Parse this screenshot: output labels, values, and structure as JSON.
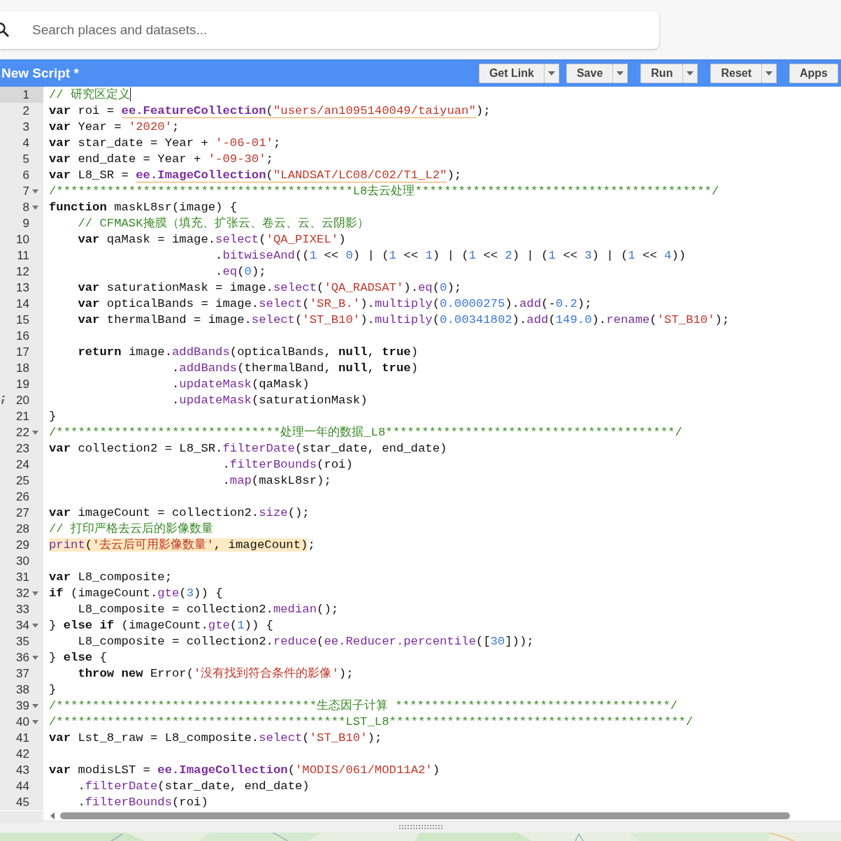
{
  "search": {
    "placeholder": "Search places and datasets..."
  },
  "toolbar": {
    "title": "New Script *",
    "buttons": [
      {
        "label": "Get Link",
        "dropdown": true
      },
      {
        "label": "Save",
        "dropdown": true
      },
      {
        "label": "Run",
        "dropdown": true
      },
      {
        "label": "Reset",
        "dropdown": true
      },
      {
        "label": "Apps",
        "dropdown": false
      }
    ]
  },
  "editor": {
    "lines": [
      {
        "number": "1",
        "fold": false,
        "info": false,
        "current": true,
        "tokens": [
          {
            "kind": "c",
            "text": "// 研究区定义"
          }
        ]
      },
      {
        "number": "2",
        "fold": false,
        "info": false,
        "current": false,
        "tokens": [
          {
            "kind": "kw",
            "text": "var"
          },
          {
            "kind": "p",
            "text": " roi = "
          },
          {
            "kind": "underline",
            "tokens": [
              {
                "kind": "fnb",
                "text": "ee.FeatureCollection"
              },
              {
                "kind": "p",
                "text": "("
              },
              {
                "kind": "s",
                "text": "\"users/an1095140049/taiyuan\""
              }
            ]
          },
          {
            "kind": "p",
            "text": ");"
          }
        ]
      },
      {
        "number": "3",
        "fold": false,
        "info": false,
        "current": false,
        "tokens": [
          {
            "kind": "kw",
            "text": "var"
          },
          {
            "kind": "p",
            "text": " Year = "
          },
          {
            "kind": "s",
            "text": "'2020'"
          },
          {
            "kind": "p",
            "text": ";"
          }
        ]
      },
      {
        "number": "4",
        "fold": false,
        "info": false,
        "current": false,
        "tokens": [
          {
            "kind": "kw",
            "text": "var"
          },
          {
            "kind": "p",
            "text": " star_date = Year + "
          },
          {
            "kind": "s",
            "text": "'-06-01'"
          },
          {
            "kind": "p",
            "text": ";"
          }
        ]
      },
      {
        "number": "5",
        "fold": false,
        "info": false,
        "current": false,
        "tokens": [
          {
            "kind": "kw",
            "text": "var"
          },
          {
            "kind": "p",
            "text": " end_date = Year + "
          },
          {
            "kind": "s",
            "text": "'-09-30'"
          },
          {
            "kind": "p",
            "text": ";"
          }
        ]
      },
      {
        "number": "6",
        "fold": false,
        "info": false,
        "current": false,
        "tokens": [
          {
            "kind": "kw",
            "text": "var"
          },
          {
            "kind": "p",
            "text": " L8_SR = "
          },
          {
            "kind": "underline",
            "tokens": [
              {
                "kind": "fnb",
                "text": "ee.ImageCollection"
              },
              {
                "kind": "p",
                "text": "("
              },
              {
                "kind": "s",
                "text": "\"LANDSAT/LC08/C02/T1_L2\""
              }
            ]
          },
          {
            "kind": "p",
            "text": ");"
          }
        ]
      },
      {
        "number": "7",
        "fold": true,
        "info": false,
        "current": false,
        "tokens": [
          {
            "kind": "c",
            "text": "/*****************************************L8去云处理*****************************************/"
          }
        ]
      },
      {
        "number": "8",
        "fold": true,
        "info": false,
        "current": false,
        "tokens": [
          {
            "kind": "kw",
            "text": "function"
          },
          {
            "kind": "p",
            "text": " maskL8sr(image) {"
          }
        ]
      },
      {
        "number": "9",
        "fold": false,
        "info": false,
        "current": false,
        "tokens": [
          {
            "kind": "c",
            "text": "    // CFMASK掩膜（填充、扩张云、卷云、云、云阴影）"
          }
        ]
      },
      {
        "number": "10",
        "fold": false,
        "info": false,
        "current": false,
        "tokens": [
          {
            "kind": "kw",
            "text": "    var"
          },
          {
            "kind": "p",
            "text": " qaMask = image."
          },
          {
            "kind": "fn",
            "text": "select"
          },
          {
            "kind": "p",
            "text": "("
          },
          {
            "kind": "s",
            "text": "'QA_PIXEL'"
          },
          {
            "kind": "p",
            "text": ")"
          }
        ]
      },
      {
        "number": "11",
        "fold": false,
        "info": false,
        "current": false,
        "tokens": [
          {
            "kind": "p",
            "text": "                       ."
          },
          {
            "kind": "fn",
            "text": "bitwiseAnd"
          },
          {
            "kind": "p",
            "text": "(("
          },
          {
            "kind": "n",
            "text": "1"
          },
          {
            "kind": "p",
            "text": " << "
          },
          {
            "kind": "n",
            "text": "0"
          },
          {
            "kind": "p",
            "text": ") | ("
          },
          {
            "kind": "n",
            "text": "1"
          },
          {
            "kind": "p",
            "text": " << "
          },
          {
            "kind": "n",
            "text": "1"
          },
          {
            "kind": "p",
            "text": ") | ("
          },
          {
            "kind": "n",
            "text": "1"
          },
          {
            "kind": "p",
            "text": " << "
          },
          {
            "kind": "n",
            "text": "2"
          },
          {
            "kind": "p",
            "text": ") | ("
          },
          {
            "kind": "n",
            "text": "1"
          },
          {
            "kind": "p",
            "text": " << "
          },
          {
            "kind": "n",
            "text": "3"
          },
          {
            "kind": "p",
            "text": ") | ("
          },
          {
            "kind": "n",
            "text": "1"
          },
          {
            "kind": "p",
            "text": " << "
          },
          {
            "kind": "n",
            "text": "4"
          },
          {
            "kind": "p",
            "text": "))"
          }
        ]
      },
      {
        "number": "12",
        "fold": false,
        "info": false,
        "current": false,
        "tokens": [
          {
            "kind": "p",
            "text": "                       ."
          },
          {
            "kind": "fn",
            "text": "eq"
          },
          {
            "kind": "p",
            "text": "("
          },
          {
            "kind": "n",
            "text": "0"
          },
          {
            "kind": "p",
            "text": ");"
          }
        ]
      },
      {
        "number": "13",
        "fold": false,
        "info": false,
        "current": false,
        "tokens": [
          {
            "kind": "kw",
            "text": "    var"
          },
          {
            "kind": "p",
            "text": " saturationMask = image."
          },
          {
            "kind": "fn",
            "text": "select"
          },
          {
            "kind": "p",
            "text": "("
          },
          {
            "kind": "s",
            "text": "'QA_RADSAT'"
          },
          {
            "kind": "p",
            "text": ")."
          },
          {
            "kind": "fn",
            "text": "eq"
          },
          {
            "kind": "p",
            "text": "("
          },
          {
            "kind": "n",
            "text": "0"
          },
          {
            "kind": "p",
            "text": ");"
          }
        ]
      },
      {
        "number": "14",
        "fold": false,
        "info": false,
        "current": false,
        "tokens": [
          {
            "kind": "kw",
            "text": "    var"
          },
          {
            "kind": "p",
            "text": " opticalBands = image."
          },
          {
            "kind": "fn",
            "text": "select"
          },
          {
            "kind": "p",
            "text": "("
          },
          {
            "kind": "s",
            "text": "'SR_B.'"
          },
          {
            "kind": "p",
            "text": ")."
          },
          {
            "kind": "fn",
            "text": "multiply"
          },
          {
            "kind": "p",
            "text": "("
          },
          {
            "kind": "n",
            "text": "0.0000275"
          },
          {
            "kind": "p",
            "text": ")."
          },
          {
            "kind": "fn",
            "text": "add"
          },
          {
            "kind": "p",
            "text": "(-"
          },
          {
            "kind": "n",
            "text": "0.2"
          },
          {
            "kind": "p",
            "text": ");"
          }
        ]
      },
      {
        "number": "15",
        "fold": false,
        "info": false,
        "current": false,
        "tokens": [
          {
            "kind": "kw",
            "text": "    var"
          },
          {
            "kind": "p",
            "text": " thermalBand = image."
          },
          {
            "kind": "fn",
            "text": "select"
          },
          {
            "kind": "p",
            "text": "("
          },
          {
            "kind": "s",
            "text": "'ST_B10'"
          },
          {
            "kind": "p",
            "text": ")."
          },
          {
            "kind": "fn",
            "text": "multiply"
          },
          {
            "kind": "p",
            "text": "("
          },
          {
            "kind": "n",
            "text": "0.00341802"
          },
          {
            "kind": "p",
            "text": ")."
          },
          {
            "kind": "fn",
            "text": "add"
          },
          {
            "kind": "p",
            "text": "("
          },
          {
            "kind": "n",
            "text": "149.0"
          },
          {
            "kind": "p",
            "text": ")."
          },
          {
            "kind": "fn",
            "text": "rename"
          },
          {
            "kind": "p",
            "text": "("
          },
          {
            "kind": "s",
            "text": "'ST_B10'"
          },
          {
            "kind": "p",
            "text": ");"
          }
        ]
      },
      {
        "number": "16",
        "fold": false,
        "info": false,
        "current": false
      },
      {
        "number": "17",
        "fold": false,
        "info": false,
        "current": false,
        "tokens": [
          {
            "kind": "kw",
            "text": "    return"
          },
          {
            "kind": "p",
            "text": " image."
          },
          {
            "kind": "fn",
            "text": "addBands"
          },
          {
            "kind": "p",
            "text": "(opticalBands, "
          },
          {
            "kind": "kw",
            "text": "null"
          },
          {
            "kind": "p",
            "text": ", "
          },
          {
            "kind": "kw",
            "text": "true"
          },
          {
            "kind": "p",
            "text": ")"
          }
        ]
      },
      {
        "number": "18",
        "fold": false,
        "info": false,
        "current": false,
        "tokens": [
          {
            "kind": "p",
            "text": "                 ."
          },
          {
            "kind": "fn",
            "text": "addBands"
          },
          {
            "kind": "p",
            "text": "(thermalBand, "
          },
          {
            "kind": "kw",
            "text": "null"
          },
          {
            "kind": "p",
            "text": ", "
          },
          {
            "kind": "kw",
            "text": "true"
          },
          {
            "kind": "p",
            "text": ")"
          }
        ]
      },
      {
        "number": "19",
        "fold": false,
        "info": false,
        "current": false,
        "tokens": [
          {
            "kind": "p",
            "text": "                 ."
          },
          {
            "kind": "fn",
            "text": "updateMask"
          },
          {
            "kind": "p",
            "text": "(qaMask)"
          }
        ]
      },
      {
        "number": "20",
        "fold": false,
        "info": true,
        "current": false,
        "tokens": [
          {
            "kind": "p",
            "text": "                 ."
          },
          {
            "kind": "fn",
            "text": "updateMask"
          },
          {
            "kind": "p",
            "text": "(saturationMask)"
          }
        ]
      },
      {
        "number": "21",
        "fold": false,
        "info": false,
        "current": false,
        "tokens": [
          {
            "kind": "p",
            "text": "}"
          }
        ]
      },
      {
        "number": "22",
        "fold": true,
        "info": false,
        "current": false,
        "tokens": [
          {
            "kind": "c",
            "text": "/*******************************处理一年的数据_L8****************************************/"
          }
        ]
      },
      {
        "number": "23",
        "fold": false,
        "info": false,
        "current": false,
        "tokens": [
          {
            "kind": "kw",
            "text": "var"
          },
          {
            "kind": "p",
            "text": " collection2 = L8_SR."
          },
          {
            "kind": "fn",
            "text": "filterDate"
          },
          {
            "kind": "p",
            "text": "(star_date, end_date)"
          }
        ]
      },
      {
        "number": "24",
        "fold": false,
        "info": false,
        "current": false,
        "tokens": [
          {
            "kind": "p",
            "text": "                        ."
          },
          {
            "kind": "fn",
            "text": "filterBounds"
          },
          {
            "kind": "p",
            "text": "(roi)"
          }
        ]
      },
      {
        "number": "25",
        "fold": false,
        "info": false,
        "current": false,
        "tokens": [
          {
            "kind": "p",
            "text": "                        ."
          },
          {
            "kind": "fn",
            "text": "map"
          },
          {
            "kind": "p",
            "text": "(maskL8sr);"
          }
        ]
      },
      {
        "number": "26",
        "fold": false,
        "info": false,
        "current": false
      },
      {
        "number": "27",
        "fold": false,
        "info": false,
        "current": false,
        "tokens": [
          {
            "kind": "kw",
            "text": "var"
          },
          {
            "kind": "p",
            "text": " imageCount = collection2."
          },
          {
            "kind": "fn",
            "text": "size"
          },
          {
            "kind": "p",
            "text": "();"
          }
        ]
      },
      {
        "number": "28",
        "fold": false,
        "info": false,
        "current": false,
        "tokens": [
          {
            "kind": "c",
            "text": "// 打印严格去云后的影像数量"
          }
        ]
      },
      {
        "number": "29",
        "fold": false,
        "info": false,
        "current": false,
        "tokens": [
          {
            "kind": "highlight",
            "tokens": [
              {
                "kind": "fn",
                "text": "print"
              },
              {
                "kind": "p",
                "text": "("
              },
              {
                "kind": "s",
                "text": "'去云后可用影像数量'"
              },
              {
                "kind": "p",
                "text": ", imageCount)"
              }
            ]
          },
          {
            "kind": "p",
            "text": ";"
          }
        ]
      },
      {
        "number": "30",
        "fold": false,
        "info": false,
        "current": false
      },
      {
        "number": "31",
        "fold": false,
        "info": false,
        "current": false,
        "tokens": [
          {
            "kind": "kw",
            "text": "var"
          },
          {
            "kind": "p",
            "text": " L8_composite;"
          }
        ]
      },
      {
        "number": "32",
        "fold": true,
        "info": false,
        "current": false,
        "tokens": [
          {
            "kind": "kw",
            "text": "if"
          },
          {
            "kind": "p",
            "text": " (imageCount."
          },
          {
            "kind": "fn",
            "text": "gte"
          },
          {
            "kind": "p",
            "text": "("
          },
          {
            "kind": "n",
            "text": "3"
          },
          {
            "kind": "p",
            "text": ")) {"
          }
        ]
      },
      {
        "number": "33",
        "fold": false,
        "info": false,
        "current": false,
        "tokens": [
          {
            "kind": "p",
            "text": "    L8_composite = collection2."
          },
          {
            "kind": "fn",
            "text": "median"
          },
          {
            "kind": "p",
            "text": "();"
          }
        ]
      },
      {
        "number": "34",
        "fold": true,
        "info": false,
        "current": false,
        "tokens": [
          {
            "kind": "p",
            "text": "} "
          },
          {
            "kind": "kw",
            "text": "else"
          },
          {
            "kind": "kw",
            "text": " if"
          },
          {
            "kind": "p",
            "text": " (imageCount."
          },
          {
            "kind": "fn",
            "text": "gte"
          },
          {
            "kind": "p",
            "text": "("
          },
          {
            "kind": "n",
            "text": "1"
          },
          {
            "kind": "p",
            "text": ")) {"
          }
        ]
      },
      {
        "number": "35",
        "fold": false,
        "info": false,
        "current": false,
        "tokens": [
          {
            "kind": "p",
            "text": "    L8_composite = collection2."
          },
          {
            "kind": "fn",
            "text": "reduce"
          },
          {
            "kind": "p",
            "text": "("
          },
          {
            "kind": "fn",
            "text": "ee.Reducer.percentile"
          },
          {
            "kind": "p",
            "text": "(["
          },
          {
            "kind": "n",
            "text": "30"
          },
          {
            "kind": "p",
            "text": "]));"
          }
        ]
      },
      {
        "number": "36",
        "fold": true,
        "info": false,
        "current": false,
        "tokens": [
          {
            "kind": "p",
            "text": "} "
          },
          {
            "kind": "kw",
            "text": "else"
          },
          {
            "kind": "p",
            "text": " {"
          }
        ]
      },
      {
        "number": "37",
        "fold": false,
        "info": false,
        "current": false,
        "tokens": [
          {
            "kind": "kw",
            "text": "    throw"
          },
          {
            "kind": "kw",
            "text": " new"
          },
          {
            "kind": "p",
            "text": " Error("
          },
          {
            "kind": "s",
            "text": "'没有找到符合条件的影像'"
          },
          {
            "kind": "p",
            "text": ");"
          }
        ]
      },
      {
        "number": "38",
        "fold": false,
        "info": false,
        "current": false,
        "tokens": [
          {
            "kind": "p",
            "text": "}"
          }
        ]
      },
      {
        "number": "39",
        "fold": true,
        "info": false,
        "current": false,
        "tokens": [
          {
            "kind": "c",
            "text": "/************************************生态因子计算 **************************************/"
          }
        ]
      },
      {
        "number": "40",
        "fold": true,
        "info": false,
        "current": false,
        "tokens": [
          {
            "kind": "c",
            "text": "/****************************************LST_L8*****************************************/"
          }
        ]
      },
      {
        "number": "41",
        "fold": false,
        "info": false,
        "current": false,
        "tokens": [
          {
            "kind": "kw",
            "text": "var"
          },
          {
            "kind": "p",
            "text": " Lst_8_raw = L8_composite."
          },
          {
            "kind": "fn",
            "text": "select"
          },
          {
            "kind": "p",
            "text": "("
          },
          {
            "kind": "s",
            "text": "'ST_B10'"
          },
          {
            "kind": "p",
            "text": ");"
          }
        ]
      },
      {
        "number": "42",
        "fold": false,
        "info": false,
        "current": false
      },
      {
        "number": "43",
        "fold": false,
        "info": false,
        "current": false,
        "tokens": [
          {
            "kind": "kw",
            "text": "var"
          },
          {
            "kind": "p",
            "text": " modisLST = "
          },
          {
            "kind": "fnb",
            "text": "ee.ImageCollection"
          },
          {
            "kind": "p",
            "text": "("
          },
          {
            "kind": "s",
            "text": "'MODIS/061/MOD11A2'"
          },
          {
            "kind": "p",
            "text": ")"
          }
        ]
      },
      {
        "number": "44",
        "fold": false,
        "info": false,
        "current": false,
        "tokens": [
          {
            "kind": "p",
            "text": "    ."
          },
          {
            "kind": "fn",
            "text": "filterDate"
          },
          {
            "kind": "p",
            "text": "(star_date, end_date)"
          }
        ]
      },
      {
        "number": "45",
        "fold": false,
        "info": false,
        "current": false,
        "tokens": [
          {
            "kind": "p",
            "text": "    ."
          },
          {
            "kind": "fn",
            "text": "filterBounds"
          },
          {
            "kind": "p",
            "text": "(roi)"
          }
        ]
      }
    ]
  }
}
